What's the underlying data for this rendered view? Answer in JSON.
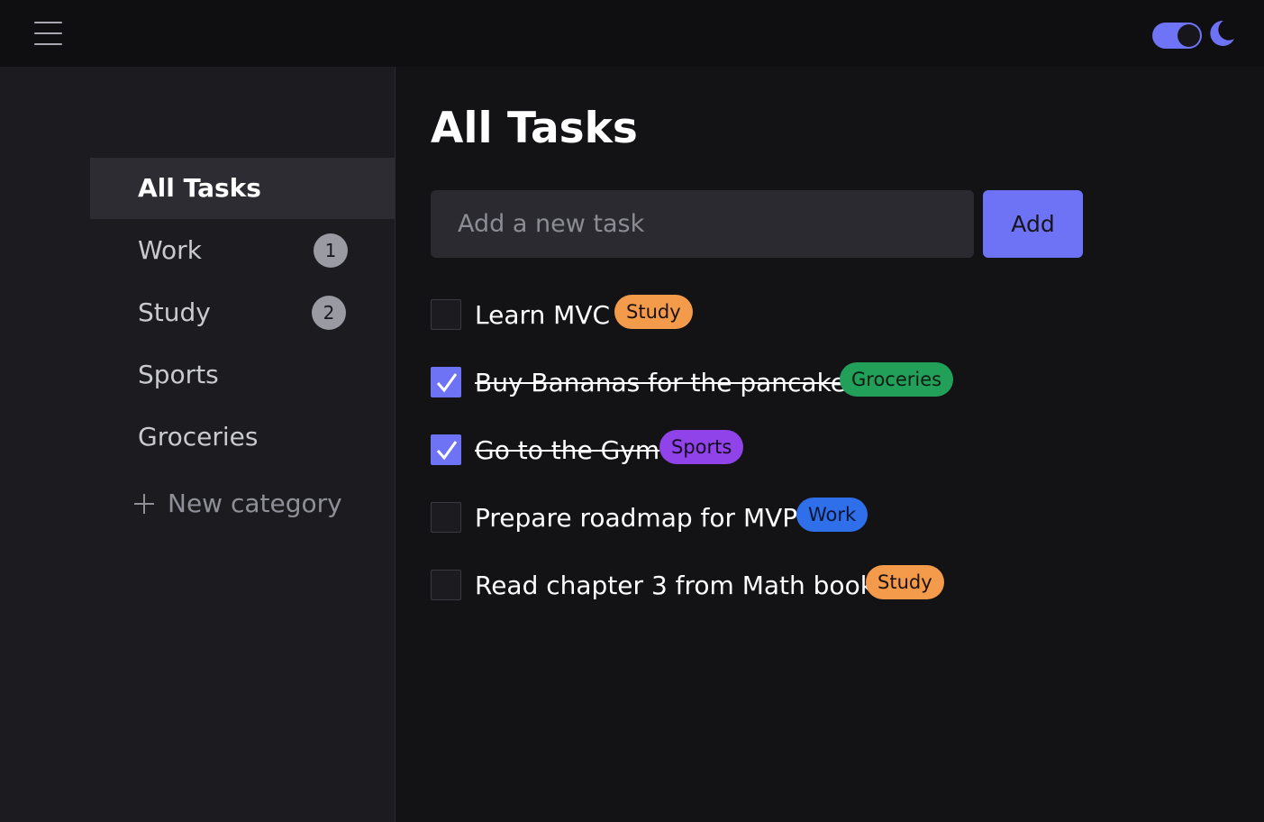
{
  "colors": {
    "accent": "#6e72f5",
    "tag_study": "#f39a4b",
    "tag_groceries": "#22a05a",
    "tag_sports": "#8f43e8",
    "tag_work": "#2f6fe9"
  },
  "header": {
    "menu_icon": "hamburger-menu-icon",
    "theme_toggle_on": true,
    "theme_icon": "moon-icon"
  },
  "sidebar": {
    "items": [
      {
        "label": "All Tasks",
        "count": null,
        "active": true
      },
      {
        "label": "Work",
        "count": "1",
        "active": false
      },
      {
        "label": "Study",
        "count": "2",
        "active": false
      },
      {
        "label": "Sports",
        "count": null,
        "active": false
      },
      {
        "label": "Groceries",
        "count": null,
        "active": false
      }
    ],
    "new_category_label": "New category",
    "new_category_icon": "plus-icon"
  },
  "main": {
    "title": "All Tasks",
    "input_placeholder": "Add a new task",
    "input_value": "",
    "add_label": "Add",
    "tasks": [
      {
        "text": "Learn MVC",
        "done": false,
        "tag": "Study"
      },
      {
        "text": "Buy Bananas for the pancakes",
        "done": true,
        "tag": "Groceries"
      },
      {
        "text": "Go to the Gym",
        "done": true,
        "tag": "Sports"
      },
      {
        "text": "Prepare roadmap for MVP",
        "done": false,
        "tag": "Work"
      },
      {
        "text": "Read chapter 3 from Math book",
        "done": false,
        "tag": "Study"
      }
    ]
  }
}
